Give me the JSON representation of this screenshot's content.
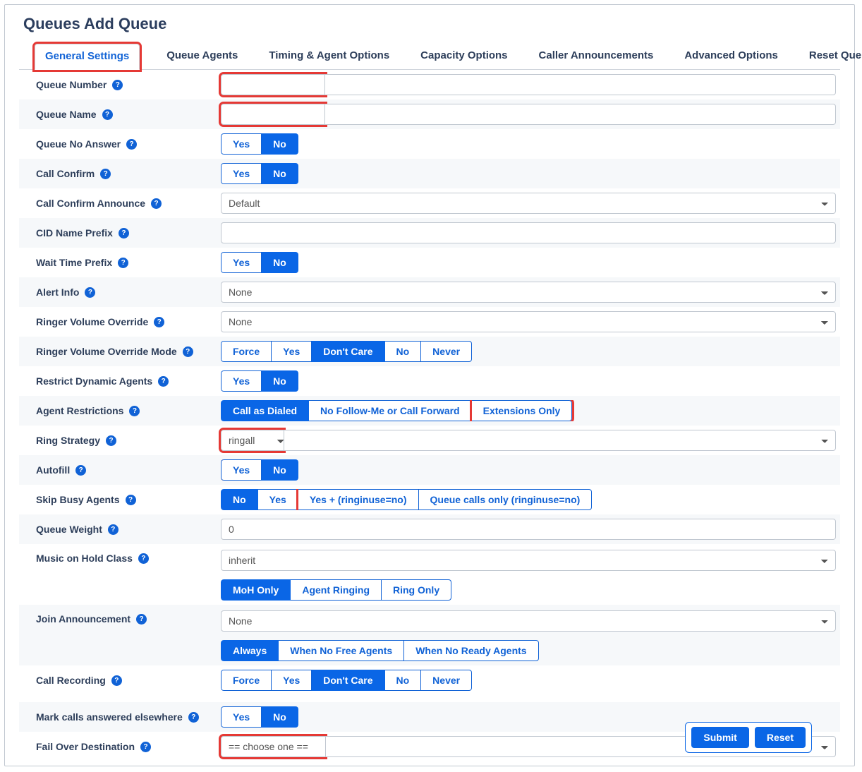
{
  "pageTitle": "Queues Add Queue",
  "tabs": [
    {
      "label": "General Settings",
      "active": true,
      "highlight": true
    },
    {
      "label": "Queue Agents"
    },
    {
      "label": "Timing & Agent Options"
    },
    {
      "label": "Capacity Options"
    },
    {
      "label": "Caller Announcements"
    },
    {
      "label": "Advanced Options"
    },
    {
      "label": "Reset Queue S"
    }
  ],
  "fields": {
    "queueNumber": {
      "label": "Queue Number",
      "value": ""
    },
    "queueName": {
      "label": "Queue Name",
      "value": ""
    },
    "queueNoAnswer": {
      "label": "Queue No Answer",
      "options": [
        "Yes",
        "No"
      ],
      "selected": "No"
    },
    "callConfirm": {
      "label": "Call Confirm",
      "options": [
        "Yes",
        "No"
      ],
      "selected": "No"
    },
    "callConfirmAnnounce": {
      "label": "Call Confirm Announce",
      "value": "Default"
    },
    "cidNamePrefix": {
      "label": "CID Name Prefix",
      "value": ""
    },
    "waitTimePrefix": {
      "label": "Wait Time Prefix",
      "options": [
        "Yes",
        "No"
      ],
      "selected": "No"
    },
    "alertInfo": {
      "label": "Alert Info",
      "value": "None"
    },
    "ringerVolumeOverride": {
      "label": "Ringer Volume Override",
      "value": "None"
    },
    "ringerVolumeOverrideMode": {
      "label": "Ringer Volume Override Mode",
      "options": [
        "Force",
        "Yes",
        "Don't Care",
        "No",
        "Never"
      ],
      "selected": "Don't Care"
    },
    "restrictDynamicAgents": {
      "label": "Restrict Dynamic Agents",
      "options": [
        "Yes",
        "No"
      ],
      "selected": "No"
    },
    "agentRestrictions": {
      "label": "Agent Restrictions",
      "options": [
        "Call as Dialed",
        "No Follow-Me or Call Forward",
        "Extensions Only"
      ],
      "selected": "Call as Dialed",
      "highlightOption": "Extensions Only"
    },
    "ringStrategy": {
      "label": "Ring Strategy",
      "value": "ringall"
    },
    "autofill": {
      "label": "Autofill",
      "options": [
        "Yes",
        "No"
      ],
      "selected": "No",
      "highlightOption": "Yes"
    },
    "skipBusyAgents": {
      "label": "Skip Busy Agents",
      "options": [
        "No",
        "Yes",
        "Yes + (ringinuse=no)",
        "Queue calls only (ringinuse=no)"
      ],
      "selected": "No",
      "highlightOption": "Yes + (ringinuse=no)"
    },
    "queueWeight": {
      "label": "Queue Weight",
      "value": "0"
    },
    "musicOnHoldClass": {
      "label": "Music on Hold Class",
      "value": "inherit",
      "modeOptions": [
        "MoH Only",
        "Agent Ringing",
        "Ring Only"
      ],
      "modeSelected": "MoH Only"
    },
    "joinAnnouncement": {
      "label": "Join Announcement",
      "value": "None",
      "whenOptions": [
        "Always",
        "When No Free Agents",
        "When No Ready Agents"
      ],
      "whenSelected": "Always"
    },
    "callRecording": {
      "label": "Call Recording",
      "options": [
        "Force",
        "Yes",
        "Don't Care",
        "No",
        "Never"
      ],
      "selected": "Don't Care"
    },
    "markCallsAnswered": {
      "label": "Mark calls answered elsewhere",
      "options": [
        "Yes",
        "No"
      ],
      "selected": "No"
    },
    "failOverDestination": {
      "label": "Fail Over Destination",
      "value": "== choose one =="
    }
  },
  "footer": {
    "submit": "Submit",
    "reset": "Reset"
  }
}
